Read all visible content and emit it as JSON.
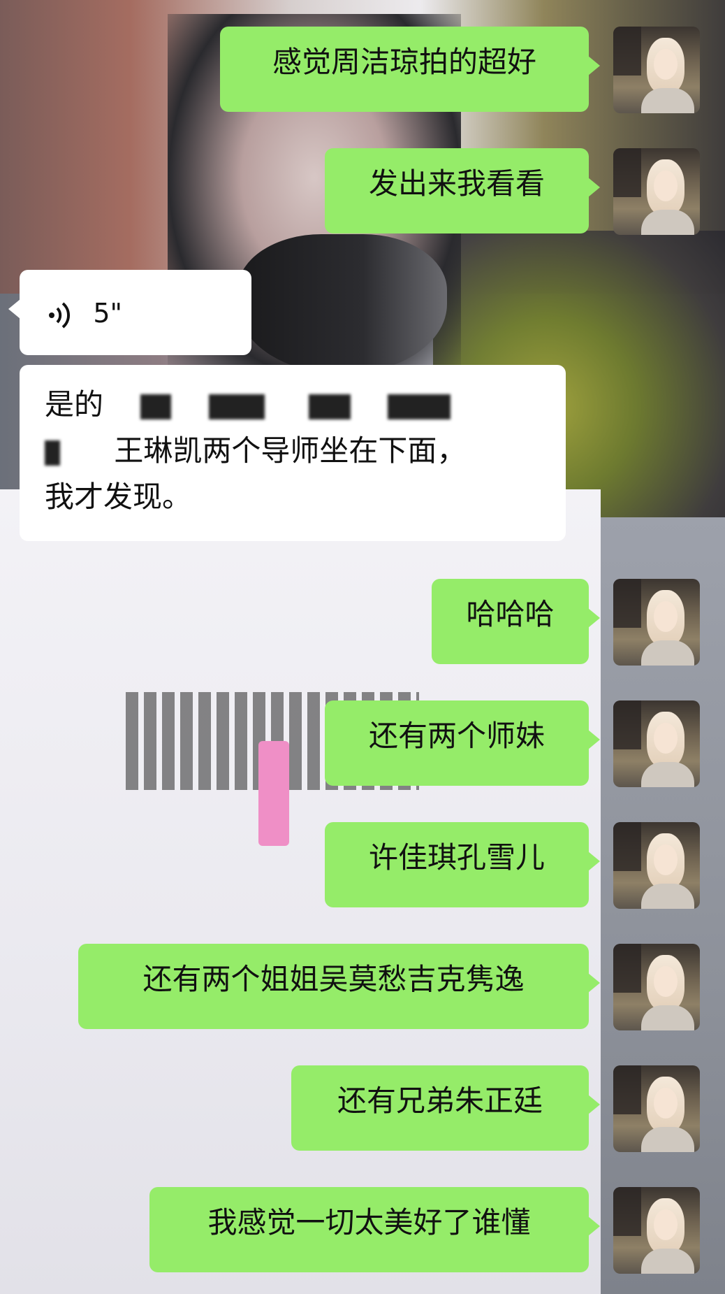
{
  "chat": {
    "messages": [
      {
        "text": "感觉周洁琼拍的超好"
      },
      {
        "text": "发出来我看看"
      },
      {
        "duration": "5\""
      },
      {
        "line1": "是的",
        "line2": "王琳凯两个导师坐在下面，",
        "line3": "我才发现。"
      },
      {
        "text": "哈哈哈"
      },
      {
        "text": "还有两个师妹"
      },
      {
        "text": "许佳琪孔雪儿"
      },
      {
        "text": "还有两个姐姐吴莫愁吉克隽逸"
      },
      {
        "text": "还有兄弟朱正廷"
      },
      {
        "text": "我感觉一切太美好了谁懂"
      }
    ]
  },
  "colors": {
    "sent_bubble": "#95ec69",
    "received_bubble": "#ffffff"
  },
  "icons": {
    "voice": "voice-wave-icon"
  }
}
